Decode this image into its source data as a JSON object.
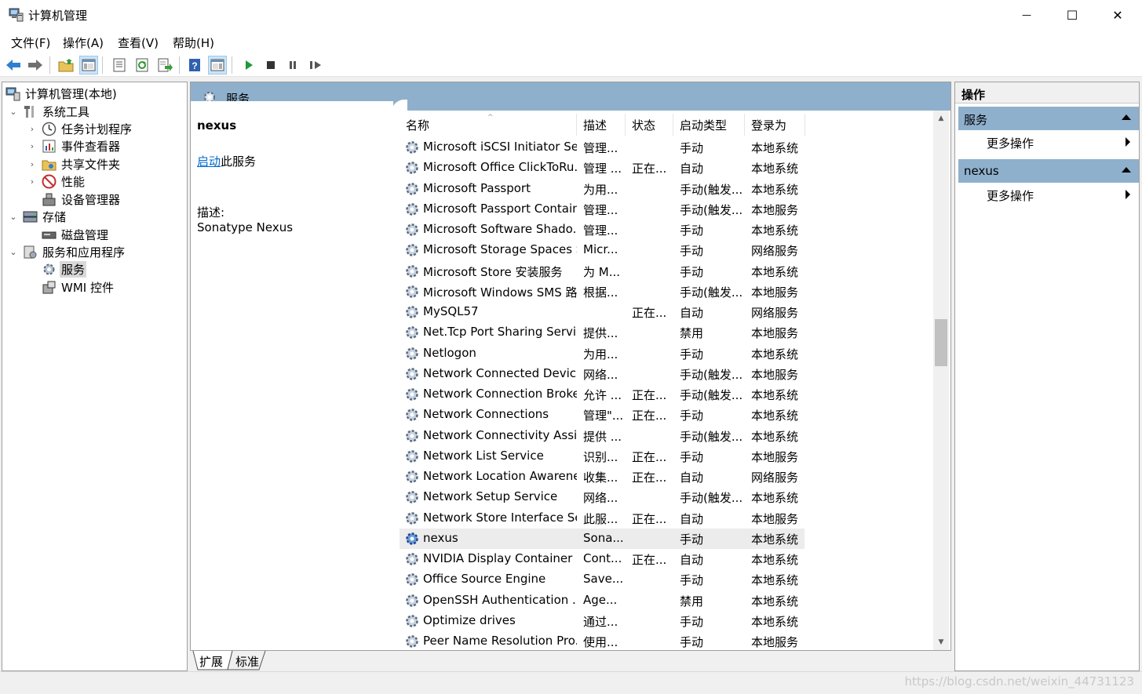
{
  "window": {
    "title": "计算机管理",
    "minimize_glyph": "—",
    "maximize_glyph": "☐",
    "close_glyph": "✕"
  },
  "menu": [
    "文件(F)",
    "操作(A)",
    "查看(V)",
    "帮助(H)"
  ],
  "toolbar": {
    "icons": [
      "back-arrow-icon",
      "forward-arrow-icon",
      "up-folder-icon",
      "show-hide-tree-icon",
      "properties-icon",
      "refresh-icon",
      "export-list-icon",
      "help-icon",
      "show-hide-action-pane-icon",
      "start-service-icon",
      "stop-service-icon",
      "pause-service-icon",
      "restart-service-icon"
    ]
  },
  "tree": {
    "root": "计算机管理(本地)",
    "system_tools": "系统工具",
    "task_scheduler": "任务计划程序",
    "event_viewer": "事件查看器",
    "shared_folders": "共享文件夹",
    "performance": "性能",
    "device_manager": "设备管理器",
    "storage": "存储",
    "disk_management": "磁盘管理",
    "services_apps": "服务和应用程序",
    "services": "服务",
    "wmi": "WMI 控件"
  },
  "center": {
    "header_title": "服务",
    "selected_service": "nexus",
    "start_link": "启动",
    "start_suffix": "此服务",
    "desc_label": "描述:",
    "desc_text": "Sonatype Nexus",
    "columns": [
      "名称",
      "描述",
      "状态",
      "启动类型",
      "登录为"
    ],
    "rows": [
      {
        "name": "Microsoft iSCSI Initiator Ser...",
        "desc": "管理...",
        "status": "",
        "startup": "手动",
        "logon": "本地系统"
      },
      {
        "name": "Microsoft Office ClickToRu...",
        "desc": "管理 ...",
        "status": "正在...",
        "startup": "自动",
        "logon": "本地系统"
      },
      {
        "name": "Microsoft Passport",
        "desc": "为用...",
        "status": "",
        "startup": "手动(触发...",
        "logon": "本地系统"
      },
      {
        "name": "Microsoft Passport Container",
        "desc": "管理...",
        "status": "",
        "startup": "手动(触发...",
        "logon": "本地服务"
      },
      {
        "name": "Microsoft Software Shado...",
        "desc": "管理...",
        "status": "",
        "startup": "手动",
        "logon": "本地系统"
      },
      {
        "name": "Microsoft Storage Spaces S...",
        "desc": "Micr...",
        "status": "",
        "startup": "手动",
        "logon": "网络服务"
      },
      {
        "name": "Microsoft Store 安装服务",
        "desc": "为 M...",
        "status": "",
        "startup": "手动",
        "logon": "本地系统"
      },
      {
        "name": "Microsoft Windows SMS 路...",
        "desc": "根据...",
        "status": "",
        "startup": "手动(触发...",
        "logon": "本地服务"
      },
      {
        "name": "MySQL57",
        "desc": "",
        "status": "正在...",
        "startup": "自动",
        "logon": "网络服务"
      },
      {
        "name": "Net.Tcp Port Sharing Service",
        "desc": "提供...",
        "status": "",
        "startup": "禁用",
        "logon": "本地服务"
      },
      {
        "name": "Netlogon",
        "desc": "为用...",
        "status": "",
        "startup": "手动",
        "logon": "本地系统"
      },
      {
        "name": "Network Connected Devic...",
        "desc": "网络...",
        "status": "",
        "startup": "手动(触发...",
        "logon": "本地服务"
      },
      {
        "name": "Network Connection Broker",
        "desc": "允许 ...",
        "status": "正在...",
        "startup": "手动(触发...",
        "logon": "本地系统"
      },
      {
        "name": "Network Connections",
        "desc": "管理\"...",
        "status": "正在...",
        "startup": "手动",
        "logon": "本地系统"
      },
      {
        "name": "Network Connectivity Assis...",
        "desc": "提供 ...",
        "status": "",
        "startup": "手动(触发...",
        "logon": "本地系统"
      },
      {
        "name": "Network List Service",
        "desc": "识别...",
        "status": "正在...",
        "startup": "手动",
        "logon": "本地服务"
      },
      {
        "name": "Network Location Awarene...",
        "desc": "收集...",
        "status": "正在...",
        "startup": "自动",
        "logon": "网络服务"
      },
      {
        "name": "Network Setup Service",
        "desc": "网络...",
        "status": "",
        "startup": "手动(触发...",
        "logon": "本地系统"
      },
      {
        "name": "Network Store Interface Se...",
        "desc": "此服...",
        "status": "正在...",
        "startup": "自动",
        "logon": "本地服务"
      },
      {
        "name": "nexus",
        "desc": "Sona...",
        "status": "",
        "startup": "手动",
        "logon": "本地系统"
      },
      {
        "name": "NVIDIA Display Container LS",
        "desc": "Cont...",
        "status": "正在...",
        "startup": "自动",
        "logon": "本地系统"
      },
      {
        "name": "Office  Source Engine",
        "desc": "Save...",
        "status": "",
        "startup": "手动",
        "logon": "本地系统"
      },
      {
        "name": "OpenSSH Authentication ...",
        "desc": "Age...",
        "status": "",
        "startup": "禁用",
        "logon": "本地系统"
      },
      {
        "name": "Optimize drives",
        "desc": "通过...",
        "status": "",
        "startup": "手动",
        "logon": "本地系统"
      },
      {
        "name": "Peer Name Resolution Pro...",
        "desc": "使用...",
        "status": "",
        "startup": "手动",
        "logon": "本地服务"
      }
    ],
    "tabs": [
      "扩展",
      "标准"
    ]
  },
  "actions": {
    "title": "操作",
    "section1": "服务",
    "section1_more": "更多操作",
    "section2": "nexus",
    "section2_more": "更多操作"
  },
  "status": {
    "watermark": "https://blog.csdn.net/weixin_44731123"
  },
  "colors": {
    "header_blue": "#8eb0cc",
    "link": "#0066cc",
    "selected_row": "#ececec"
  }
}
